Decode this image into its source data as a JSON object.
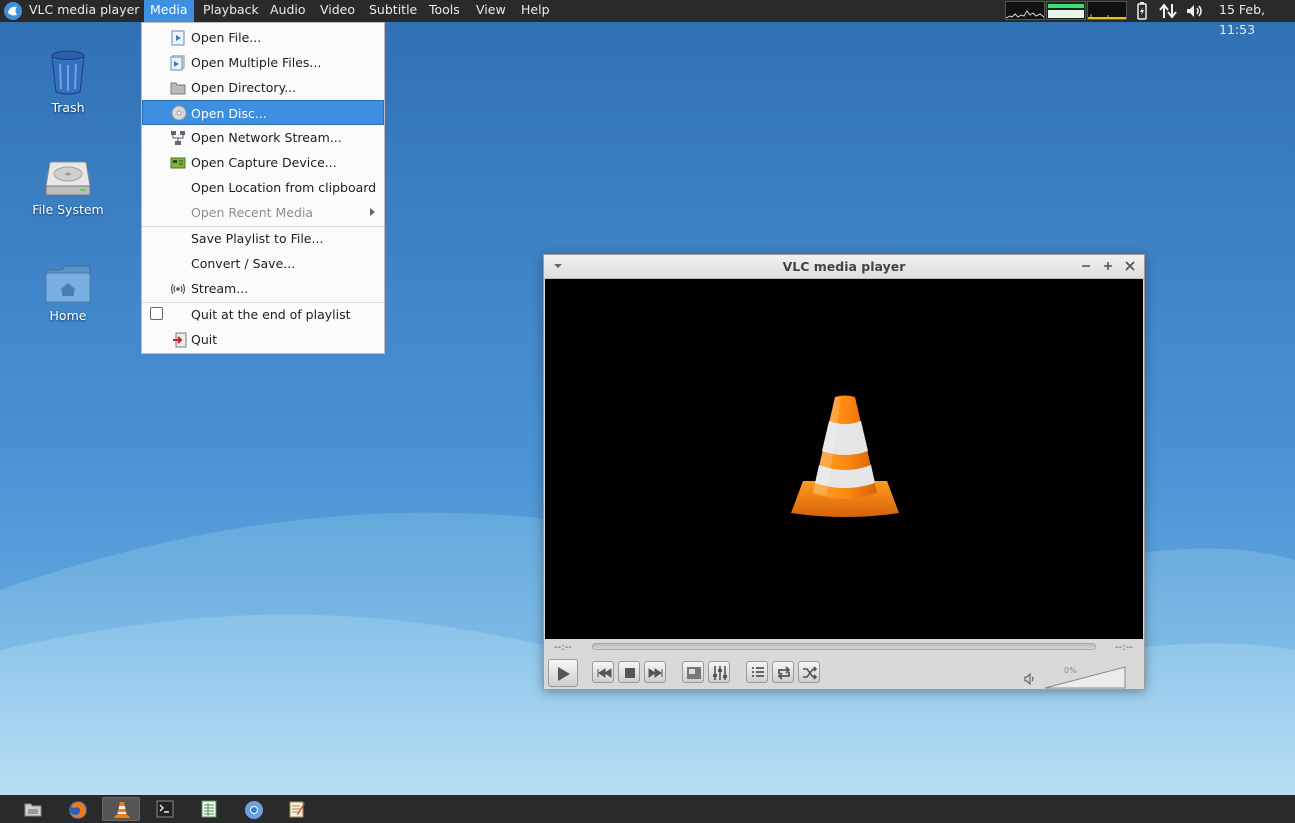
{
  "top_panel": {
    "app_name": "VLC media player",
    "menus": [
      {
        "label": "Media",
        "active": true
      },
      {
        "label": "Playback"
      },
      {
        "label": "Audio"
      },
      {
        "label": "Video"
      },
      {
        "label": "Subtitle"
      },
      {
        "label": "Tools"
      },
      {
        "label": "View"
      },
      {
        "label": "Help"
      }
    ],
    "clock": "15 Feb, 11:53",
    "tray_icons": [
      "cpu-graph-icon",
      "network-graph-icon",
      "disk-graph-icon",
      "battery-icon",
      "network-transfer-icon",
      "volume-icon"
    ]
  },
  "desktop": {
    "icons": [
      {
        "label": "Trash",
        "icon": "trash-icon"
      },
      {
        "label": "File System",
        "icon": "hard-drive-icon"
      },
      {
        "label": "Home",
        "icon": "home-folder-icon"
      }
    ]
  },
  "media_menu": {
    "items": [
      {
        "label": "Open File...",
        "icon": "file-play-icon"
      },
      {
        "label": "Open Multiple Files...",
        "icon": "files-play-icon"
      },
      {
        "label": "Open Directory...",
        "icon": "folder-icon"
      },
      {
        "label": "Open Disc...",
        "icon": "disc-icon",
        "highlighted": true
      },
      {
        "label": "Open Network Stream...",
        "icon": "network-icon"
      },
      {
        "label": "Open Capture Device...",
        "icon": "capture-card-icon"
      },
      {
        "label": "Open Location from clipboard"
      },
      {
        "label": "Open Recent Media",
        "disabled": true,
        "has_submenu": true
      },
      {
        "label": "Save Playlist to File..."
      },
      {
        "label": "Convert / Save..."
      },
      {
        "label": "Stream...",
        "icon": "stream-icon"
      },
      {
        "label": "Quit at the end of playlist",
        "checked": false
      },
      {
        "label": "Quit",
        "icon": "quit-icon"
      }
    ]
  },
  "vlc_window": {
    "title": "VLC media player",
    "elapsed": "--:--",
    "remaining": "--:--",
    "seek_position": 0,
    "volume_label": "0%",
    "volume_level": 0,
    "controls": [
      "play-icon",
      "previous-icon",
      "stop-icon",
      "next-icon",
      "fullscreen-icon",
      "extended-settings-icon",
      "playlist-icon",
      "loop-icon",
      "shuffle-icon"
    ]
  },
  "taskbar": {
    "apps": [
      {
        "icon": "file-manager-icon"
      },
      {
        "icon": "firefox-icon"
      },
      {
        "icon": "vlc-icon",
        "active": true
      },
      {
        "icon": "terminal-icon"
      },
      {
        "icon": "spreadsheet-icon"
      },
      {
        "icon": "chromium-icon"
      },
      {
        "icon": "text-editor-icon"
      }
    ]
  },
  "colors": {
    "panel": "#2a2a2a",
    "accent": "#3d8fe0",
    "desktop": "#3f84c9",
    "cone_orange": "#f47d12"
  }
}
